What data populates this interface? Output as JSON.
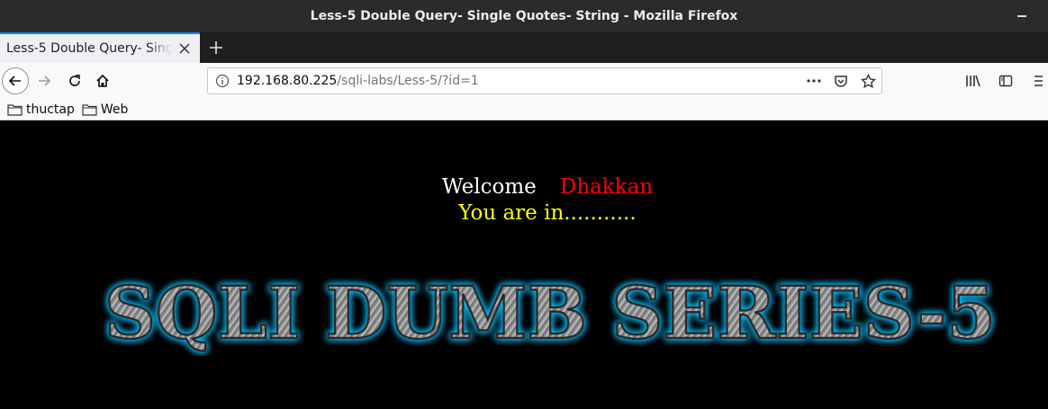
{
  "window": {
    "title": "Less-5 Double Query- Single Quotes- String - Mozilla Firefox"
  },
  "tabs": [
    {
      "label": "Less-5 Double Query- Single Quotes- String",
      "active": true
    }
  ],
  "urlbar": {
    "host": "192.168.80.225",
    "path": "/sqli-labs/Less-5/?id=1"
  },
  "bookmarks": [
    {
      "label": "thuctap",
      "icon": "folder-icon"
    },
    {
      "label": "Web",
      "icon": "folder-icon"
    }
  ],
  "page": {
    "welcome": "Welcome",
    "name": "Dhakkan",
    "message": "You are in...........",
    "banner": "SQLI DUMB SERIES-5"
  },
  "colors": {
    "welcome": "#ffffff",
    "name": "#ff0000",
    "message": "#ffff00",
    "banner_glow": "#00bfff",
    "tab_accent": "#0a84ff"
  }
}
